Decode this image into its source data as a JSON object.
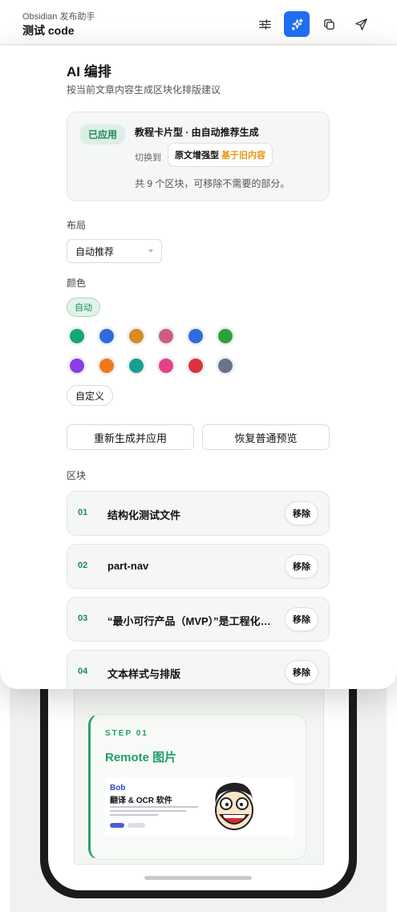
{
  "header": {
    "app_name": "Obsidian 发布助手",
    "doc_title": "测试 code"
  },
  "toolbar": {
    "icons": [
      "sliders-icon",
      "sparkles-icon",
      "copy-icon",
      "send-icon"
    ],
    "accent": "#1f6ff2"
  },
  "panel": {
    "title": "AI 编排",
    "subtitle": "按当前文章内容生成区块化排版建议",
    "status": {
      "badge": "已应用",
      "mode_title": "教程卡片型 · 由自动推荐生成",
      "switch_label": "切换到",
      "switch_target": "原文增强型",
      "switch_tag": "基于旧内容",
      "count_note": "共 9 个区块，可移除不需要的部分。"
    },
    "layout_label": "布局",
    "layout_value": "自动推荐",
    "color_label": "颜色",
    "color_auto": "自动",
    "swatches": [
      "#17a673",
      "#2f6bdf",
      "#d98b24",
      "#cc5c86",
      "#2f6bdf",
      "#2aa13c",
      "#8a3ee6",
      "#f0791b",
      "#16a08f",
      "#e83f8a",
      "#dc3341",
      "#697489"
    ],
    "custom_label": "自定义",
    "regenerate_label": "重新生成并应用",
    "restore_label": "恢复普通预览",
    "blocks_label": "区块",
    "remove_label": "移除",
    "blocks": [
      {
        "num": "01",
        "name": "结构化测试文件"
      },
      {
        "num": "02",
        "name": "part-nav"
      },
      {
        "num": "03",
        "name": "“最小可行产品（MVP）”是工程化思维"
      },
      {
        "num": "04",
        "name": "文本样式与排版"
      }
    ]
  },
  "preview": {
    "step_label": "STEP 01",
    "step_title": "Remote 图片",
    "banner_brand": "Bob",
    "banner_title": "翻译 & OCR 软件"
  }
}
